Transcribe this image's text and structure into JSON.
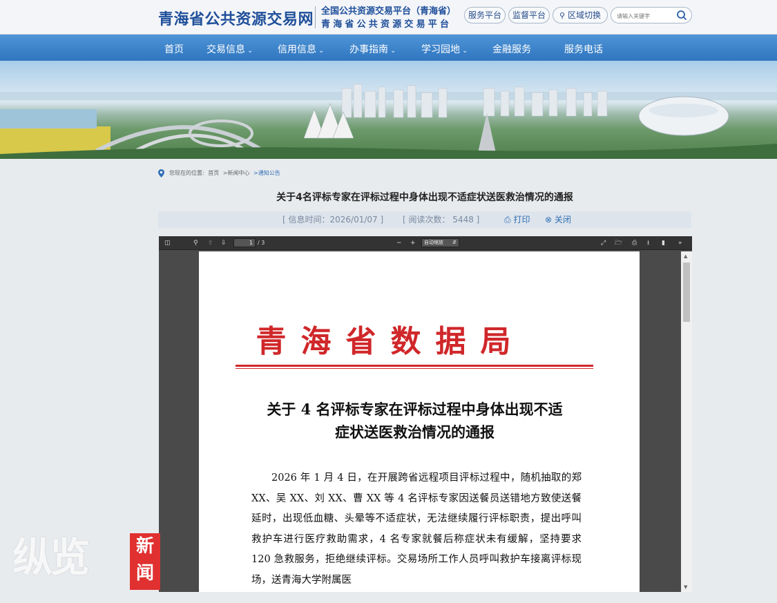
{
  "header": {
    "site_title": "青海省公共资源交易网",
    "platform_line1": "全国公共资源交易平台（青海省）",
    "platform_line2": "青海省公共资源交易平台",
    "buttons": [
      "服务平台",
      "监督平台",
      "区域切换"
    ],
    "search_placeholder": "请输入关键字"
  },
  "nav": {
    "items": [
      {
        "label": "首页",
        "dropdown": false
      },
      {
        "label": "交易信息",
        "dropdown": true
      },
      {
        "label": "信用信息",
        "dropdown": true
      },
      {
        "label": "办事指南",
        "dropdown": true
      },
      {
        "label": "学习园地",
        "dropdown": true
      },
      {
        "label": "金融服务",
        "dropdown": false
      },
      {
        "label": "服务电话",
        "dropdown": false
      }
    ]
  },
  "breadcrumb": {
    "prefix": "您现在的位置:",
    "items": [
      "首页",
      ">新闻中心",
      ">通知公告"
    ]
  },
  "article": {
    "title": "关于4名评标专家在评标过程中身体出现不适症状送医救治情况的通报",
    "info_time": "[ 信息时间：2026/01/07 ]",
    "read_count": "[ 阅读次数：  5448 ]",
    "print": "打印",
    "close": "关闭"
  },
  "pdf": {
    "page_current": "1",
    "page_total": "/ 3",
    "zoom": "自动缩放",
    "org": "青海省数据局",
    "doc_title_line1": "关于 4 名评标专家在评标过程中身体出现不适",
    "doc_title_line2": "症状送医救治情况的通报",
    "body": "2026 年 1 月 4 日，在开展跨省远程项目评标过程中，随机抽取的郑 XX、吴 XX、刘 XX、曹 XX 等 4 名评标专家因送餐员送错地方致使送餐延时，出现低血糖、头晕等不适症状，无法继续履行评标职责，提出呼叫救护车进行医疗救助需求，4 名专家就餐后称症状未有缓解，坚持要求 120 急救服务，拒绝继续评标。交易场所工作人员呼叫救护车接离评标现场，送青海大学附属医"
  },
  "watermark": {
    "text": "纵览",
    "box_text": "新闻"
  },
  "colors": {
    "brand": "#1f4f9a",
    "nav": "#3a82cc",
    "doc_red": "#d0272a"
  }
}
